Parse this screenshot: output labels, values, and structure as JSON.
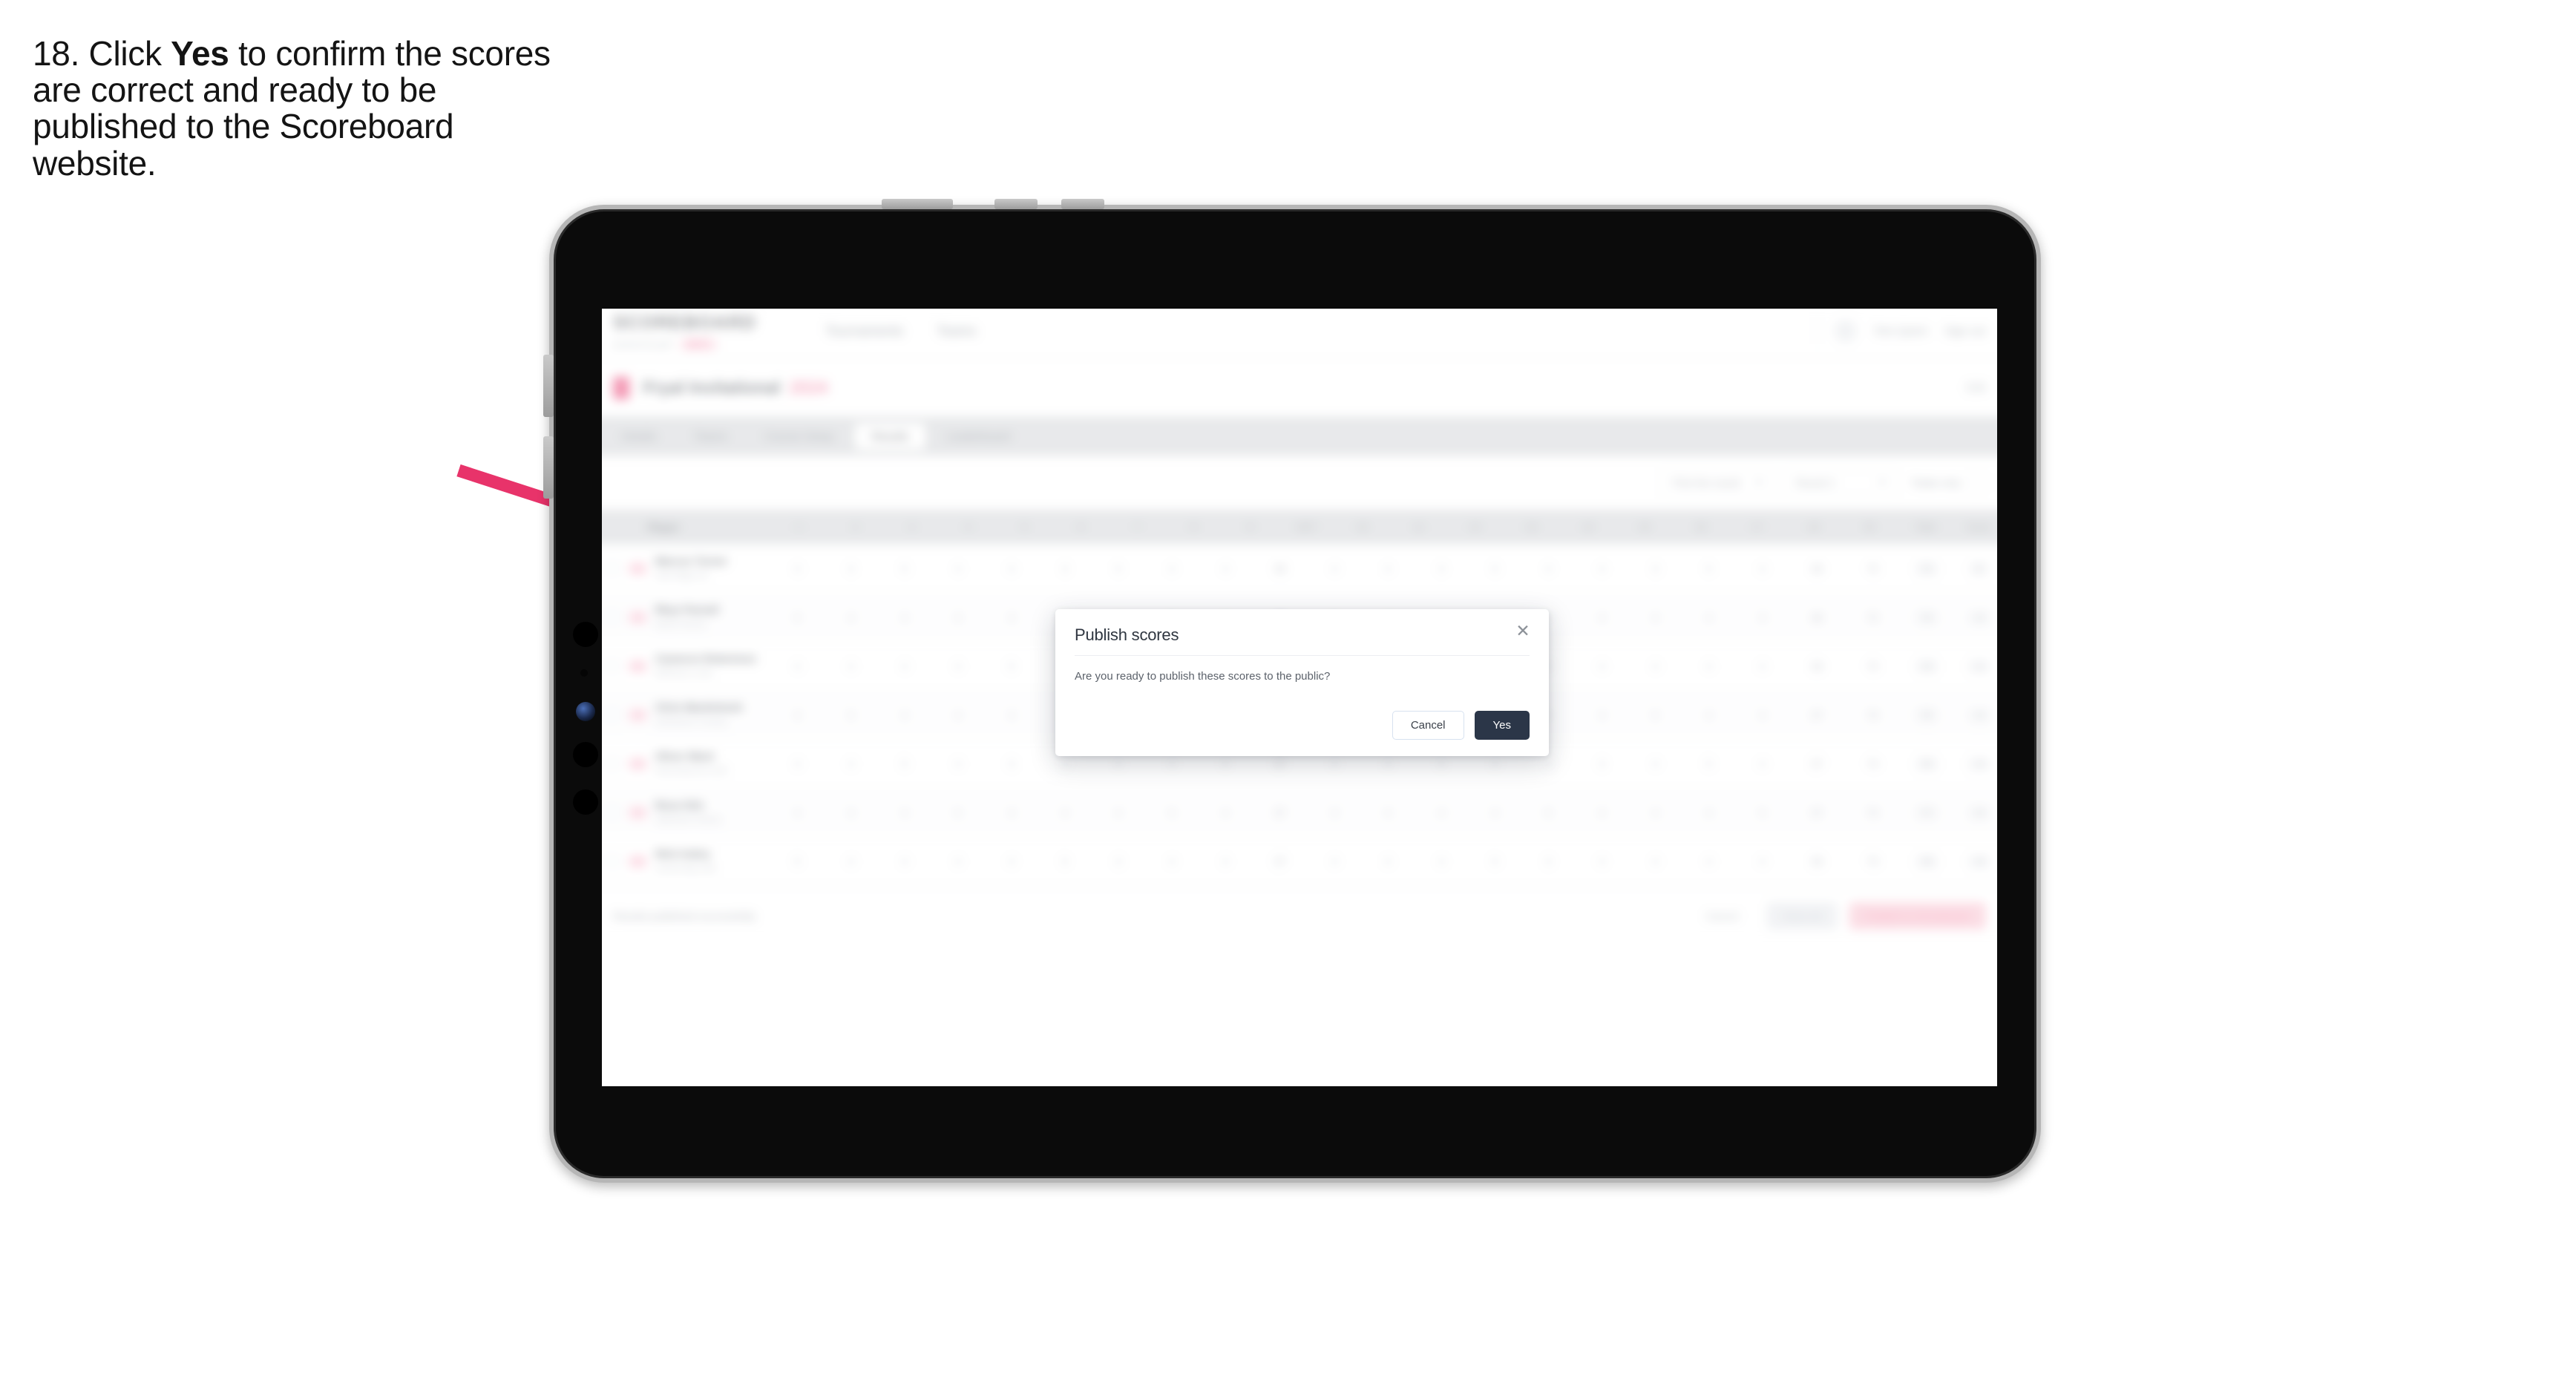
{
  "caption": {
    "prefix": "18. Click ",
    "emphasis": "Yes",
    "suffix": " to confirm the scores are correct and ready to be published to the Scoreboard website."
  },
  "colors": {
    "arrow": "#E8336A",
    "accent": "#E8336A",
    "primary_button": "#2B3648",
    "tablet_body": "#0B0B0B",
    "tablet_rim": "#B6B6B6"
  },
  "modal": {
    "title": "Publish scores",
    "close_icon": "close-icon",
    "body": "Are you ready to publish these scores to the public?",
    "cancel_label": "Cancel",
    "confirm_label": "Yes"
  },
  "app": {
    "header": {
      "logo": "SCOREBOARD",
      "logo_sub": "powered by golf",
      "logo_pill": "BETA",
      "nav": [
        "Tournaments",
        "Teams"
      ],
      "user_name": "Tom Quinn",
      "sign_out": "Sign out",
      "avatar": "avatar"
    },
    "title_bar": {
      "event": "Fryal Invitational",
      "year": "2024",
      "right_link": "Edit"
    },
    "tabs": [
      {
        "label": "Details"
      },
      {
        "label": "Teams"
      },
      {
        "label": "Course Setup"
      },
      {
        "label": "Results"
      },
      {
        "label": "Leaderboard"
      }
    ],
    "active_tab_index": 3,
    "filters": {
      "search_placeholder": "Search",
      "select_round": "Pick the round",
      "select_sort": "Round 1",
      "toggle_label": "Totals only"
    },
    "table": {
      "columns": [
        "Player",
        "1",
        "2",
        "3",
        "4",
        "5",
        "6",
        "7",
        "8",
        "9",
        "OUT",
        "10",
        "11",
        "12",
        "13",
        "14",
        "15",
        "16",
        "17",
        "18",
        "IN",
        "Total",
        "Score"
      ],
      "rows": [
        {
          "name": "Marcus Turner",
          "club": "Oak Ridge GC",
          "scores": [
            "4",
            "3",
            "5",
            "4",
            "4",
            "3",
            "5",
            "4",
            "4",
            "36",
            "4",
            "4",
            "3",
            "5",
            "4",
            "4",
            "3",
            "5",
            "4",
            "36",
            "72"
          ],
          "total": "72",
          "score": "E"
        },
        {
          "name": "Rhys Parnell",
          "club": "Mount Vernon",
          "scores": [
            "5",
            "4",
            "4",
            "3",
            "4",
            "4",
            "4",
            "5",
            "3",
            "36",
            "5",
            "3",
            "4",
            "4",
            "5",
            "4",
            "4",
            "4",
            "3",
            "36",
            "72"
          ],
          "total": "74",
          "score": "+2"
        },
        {
          "name": "Cameron Robertson",
          "club": "Bellhaven Links",
          "scores": [
            "4",
            "4",
            "4",
            "4",
            "5",
            "3",
            "4",
            "4",
            "4",
            "36",
            "4",
            "5",
            "3",
            "4",
            "4",
            "4",
            "4",
            "4",
            "4",
            "36",
            "72"
          ],
          "total": "73",
          "score": "+1"
        },
        {
          "name": "Chris Mackintosh",
          "club": "Northshore Country",
          "scores": [
            "3",
            "5",
            "4",
            "4",
            "4",
            "4",
            "5",
            "4",
            "4",
            "37",
            "4",
            "4",
            "4",
            "3",
            "5",
            "4",
            "5",
            "4",
            "4",
            "37",
            "74"
          ],
          "total": "75",
          "score": "+3"
        },
        {
          "name": "Oliver Ward",
          "club": "Ravensbourne Golf",
          "scores": [
            "4",
            "4",
            "5",
            "4",
            "3",
            "4",
            "4",
            "4",
            "5",
            "37",
            "4",
            "4",
            "5",
            "4",
            "4",
            "3",
            "4",
            "5",
            "4",
            "37",
            "74"
          ],
          "total": "76",
          "score": "+4"
        },
        {
          "name": "Ross Kiln",
          "club": "Saltmarsh Greens",
          "scores": [
            "4",
            "3",
            "4",
            "5",
            "4",
            "4",
            "4",
            "5",
            "4",
            "37",
            "3",
            "4",
            "4",
            "4",
            "5",
            "4",
            "4",
            "4",
            "5",
            "37",
            "74"
          ],
          "total": "77",
          "score": "+5"
        },
        {
          "name": "Nick Aubry",
          "club": "Carrick Bay Golf",
          "scores": [
            "5",
            "4",
            "4",
            "4",
            "4",
            "5",
            "3",
            "4",
            "4",
            "37",
            "4",
            "4",
            "4",
            "5",
            "3",
            "4",
            "4",
            "4",
            "4",
            "36",
            "73"
          ],
          "total": "78",
          "score": "+6"
        }
      ]
    },
    "footer": {
      "note": "Results published successfully",
      "link": "Cancel",
      "save_label": "Save all",
      "publish_label": "Publish to Scoreboard"
    }
  }
}
